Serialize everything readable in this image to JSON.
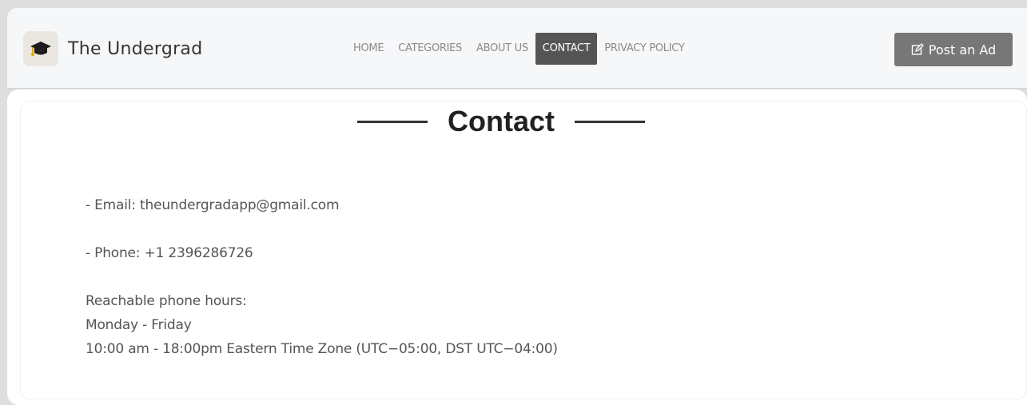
{
  "brand": {
    "name": "The Undergrad",
    "logo_icon": "graduation-cap-icon"
  },
  "nav": {
    "items": [
      {
        "label": "HOME",
        "active": false
      },
      {
        "label": "CATEGORIES",
        "active": false
      },
      {
        "label": "ABOUT US",
        "active": false
      },
      {
        "label": "CONTACT",
        "active": true
      },
      {
        "label": "PRIVACY POLICY",
        "active": false
      }
    ]
  },
  "post_button": {
    "label": "Post an Ad",
    "icon": "edit-icon"
  },
  "page": {
    "title": "Contact",
    "email_line": "- Email: theundergradapp@gmail.com",
    "phone_line": "- Phone: +1 2396286726",
    "hours_title": "Reachable phone hours:",
    "hours_days": "Monday - Friday",
    "hours_time": "10:00 am - 18:00pm Eastern Time Zone (UTC−05:00, DST UTC−04:00)"
  },
  "colors": {
    "active_nav_bg": "#555555",
    "post_button_bg": "#777777"
  }
}
